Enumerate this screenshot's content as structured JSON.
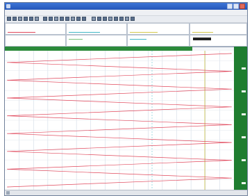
{
  "window": {
    "title": ""
  },
  "menu": {
    "items": [
      "",
      "",
      "",
      "",
      "",
      "",
      ""
    ]
  },
  "toolbar": {
    "button_count": 22
  },
  "info_panel": {
    "cells": [
      {
        "label": "",
        "value": ""
      },
      {
        "label": "",
        "value": ""
      },
      {
        "label": "",
        "value": ""
      },
      {
        "label": "",
        "value": ""
      },
      {
        "label": "",
        "value": ""
      },
      {
        "label": "",
        "value": ""
      },
      {
        "label": "",
        "value": ""
      },
      {
        "label": "",
        "value": ""
      }
    ]
  },
  "green_strip": {
    "title": ""
  },
  "chart_data": {
    "type": "line",
    "title": "",
    "xlabel": "",
    "ylabel": "",
    "grid": true,
    "series": [
      {
        "color": "#e0465a",
        "values": [
          1,
          0,
          1,
          0,
          1,
          0,
          1,
          0,
          1,
          0,
          1,
          0,
          1,
          0,
          1,
          0
        ]
      }
    ]
  },
  "status": {
    "text": ""
  },
  "colors": {
    "titlebar": "#2c5fc4",
    "rail": "#1f7d30",
    "trace": "#e0465a",
    "accent_line": "#d4c84a",
    "cyan_line": "#3fb6c6"
  }
}
